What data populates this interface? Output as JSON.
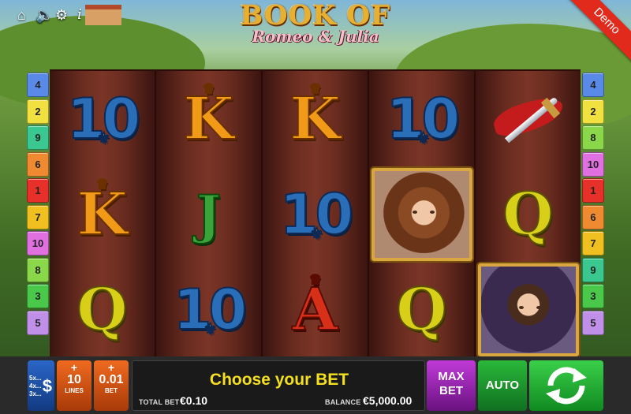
{
  "game": {
    "title_top": "BOOK OF",
    "title_sub": "Romeo & Julia",
    "mode_badge": "Demo"
  },
  "top_icons": [
    "home-icon",
    "speaker-icon",
    "gear-icon",
    "info-icon"
  ],
  "reels": [
    [
      "10",
      "K",
      "Q"
    ],
    [
      "K",
      "J",
      "10"
    ],
    [
      "K",
      "10",
      "A"
    ],
    [
      "10",
      "Juliet",
      "Q"
    ],
    [
      "Dagger",
      "Q",
      "Romeo"
    ]
  ],
  "paylines_left": [
    "4",
    "2",
    "9",
    "6",
    "1",
    "7",
    "10",
    "8",
    "3",
    "5"
  ],
  "paylines_right": [
    "4",
    "2",
    "8",
    "10",
    "1",
    "6",
    "7",
    "9",
    "3",
    "5"
  ],
  "payline_colors": {
    "1": "#e8302a",
    "2": "#f0e040",
    "3": "#4ac84a",
    "4": "#5a8ae8",
    "5": "#c090e8",
    "6": "#f08a30",
    "7": "#f0c020",
    "8": "#8ad84a",
    "9": "#3ac890",
    "10": "#e070e0"
  },
  "controls": {
    "multipliers": [
      "5x...",
      "4x...",
      "3x..."
    ],
    "currency_icon": "$",
    "lines": {
      "plus": "+",
      "value": "10",
      "label": "LINES"
    },
    "bet": {
      "plus": "+",
      "value": "0.01",
      "label": "BET"
    },
    "message": "Choose your BET",
    "total_bet_label": "TOTAL BET",
    "total_bet_value": "€0.10",
    "balance_label": "BALANCE",
    "balance_value": "€5,000.00",
    "max_bet_line1": "MAX",
    "max_bet_line2": "BET",
    "auto_label": "AUTO"
  }
}
